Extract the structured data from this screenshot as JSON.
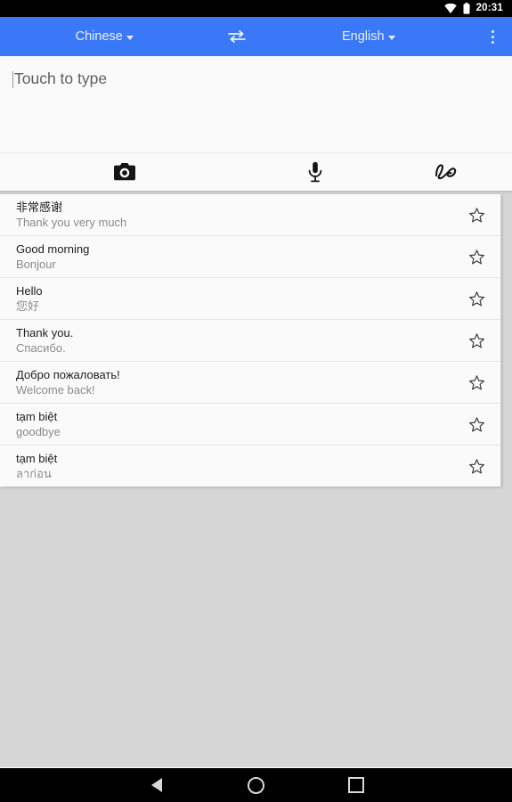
{
  "statusbar": {
    "time": "20:31",
    "wifi_icon": "wifi-icon",
    "battery_icon": "battery-icon"
  },
  "toolbar": {
    "source_language": "Chinese",
    "target_language": "English",
    "swap_icon": "swap-languages-icon",
    "overflow_icon": "overflow-menu-icon",
    "accent_color": "#3b78f7",
    "label_color": "#e9f0fe"
  },
  "input": {
    "placeholder": "Touch to type",
    "value": "",
    "methods": [
      {
        "name": "camera-input",
        "icon": "camera-icon"
      },
      {
        "name": "voice-input",
        "icon": "microphone-icon"
      },
      {
        "name": "handwriting-input",
        "icon": "handwriting-icon"
      }
    ]
  },
  "history": {
    "star_icon": "star-outline-icon",
    "items": [
      {
        "source": "非常感谢",
        "target": "Thank you very much",
        "starred": false
      },
      {
        "source": "Good morning",
        "target": "Bonjour",
        "starred": false
      },
      {
        "source": "Hello",
        "target": "您好",
        "starred": false
      },
      {
        "source": "Thank you.",
        "target": "Спасибо.",
        "starred": false
      },
      {
        "source": "Добро пожаловать!",
        "target": "Welcome back!",
        "starred": false
      },
      {
        "source": "tạm biệt",
        "target": "goodbye",
        "starred": false
      },
      {
        "source": "tạm biệt",
        "target": "ลาก่อน",
        "starred": false
      }
    ]
  },
  "navbar": {
    "back": "back-button",
    "home": "home-button",
    "recents": "recents-button"
  }
}
